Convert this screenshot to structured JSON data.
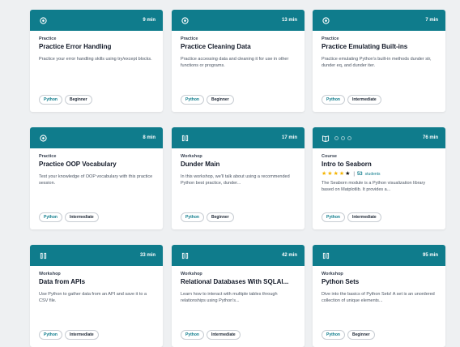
{
  "theme": {
    "header_color": "#0f7c8c",
    "star_color": "#f5b400"
  },
  "cards": [
    {
      "icon": "target-icon",
      "duration": "9 min",
      "type": "Practice",
      "title": "Practice Error Handling",
      "description": "Practice your error handling skills using try/except blocks.",
      "tags": [
        "Python",
        "Beginner"
      ]
    },
    {
      "icon": "target-icon",
      "duration": "13 min",
      "type": "Practice",
      "title": "Practice Cleaning Data",
      "description": "Practice accessing data and cleaning it for use in other functions or programs.",
      "tags": [
        "Python",
        "Beginner"
      ]
    },
    {
      "icon": "target-icon",
      "duration": "7 min",
      "type": "Practice",
      "title": "Practice Emulating Built-ins",
      "description": "Practice emulating Python's built-in methods dunder str, dunder eq, and dunder iter.",
      "tags": [
        "Python",
        "Intermediate"
      ]
    },
    {
      "icon": "target-icon",
      "duration": "8 min",
      "type": "Practice",
      "title": "Practice OOP Vocabulary",
      "description": "Test your knowledge of OOP vocabulary with this practice session.",
      "tags": [
        "Python",
        "Intermediate"
      ]
    },
    {
      "icon": "workshop-icon",
      "duration": "17 min",
      "type": "Workshop",
      "title": "Dunder Main",
      "description": "In this workshop, we'll talk about using a recommended Python best practice, dunder...",
      "tags": [
        "Python",
        "Beginner"
      ]
    },
    {
      "icon": "book-icon",
      "duration": "76 min",
      "type": "Course",
      "title": "Intro to Seaborn",
      "rating": 4,
      "students": "53",
      "students_label": "students",
      "description": "The Seaborn module is a Python visualization library based on Matplotlib. It provides a...",
      "tags": [
        "Python",
        "Intermediate"
      ]
    },
    {
      "icon": "workshop-icon",
      "duration": "33 min",
      "type": "Workshop",
      "title": "Data from APIs",
      "description": "Use Python to gather data from an API and save it to a CSV file.",
      "tags": [
        "Python",
        "Intermediate"
      ]
    },
    {
      "icon": "workshop-icon",
      "duration": "42 min",
      "type": "Workshop",
      "title": "Relational Databases With SQLAl...",
      "description": "Learn how to interact with multiple tables through relationships using Python's...",
      "tags": [
        "Python",
        "Intermediate"
      ]
    },
    {
      "icon": "workshop-icon",
      "duration": "95 min",
      "type": "Workshop",
      "title": "Python Sets",
      "description": "Dive into the basics of Python Sets! A set is an unordered collection of unique elements...",
      "tags": [
        "Python",
        "Beginner"
      ]
    }
  ]
}
